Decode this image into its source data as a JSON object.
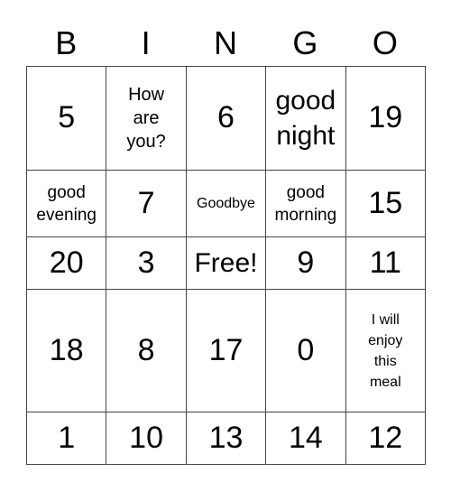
{
  "header": [
    "B",
    "I",
    "N",
    "G",
    "O"
  ],
  "cells": [
    "5",
    "How are you?",
    "6",
    "good night",
    "19",
    "good evening",
    "7",
    "Goodbye",
    "good morning",
    "15",
    "20",
    "3",
    "Free!",
    "9",
    "11",
    "18",
    "8",
    "17",
    "0",
    "I will enjoy this meal",
    "1",
    "10",
    "13",
    "14",
    "12"
  ]
}
